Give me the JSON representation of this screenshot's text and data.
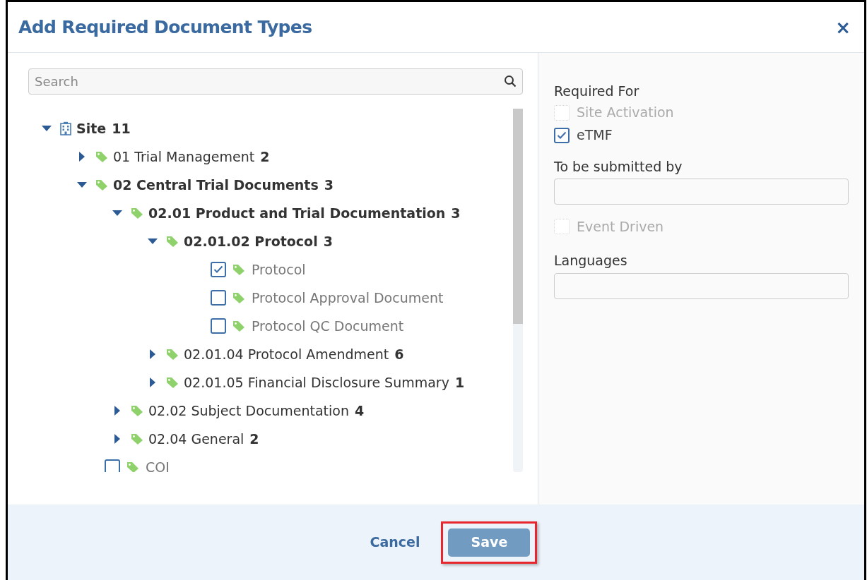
{
  "dialog": {
    "title": "Add Required Document Types",
    "close": "×"
  },
  "search": {
    "placeholder": "Search"
  },
  "tree": [
    {
      "kind": "site",
      "name": "Site",
      "count": "11",
      "expanded": true,
      "children": [
        {
          "kind": "folder",
          "name": "01 Trial Management",
          "count": "2",
          "expanded": false
        },
        {
          "kind": "folder",
          "name": "02 Central Trial Documents",
          "count": "3",
          "expanded": true,
          "children": [
            {
              "kind": "folder",
              "name": "02.01 Product and Trial Documentation",
              "count": "3",
              "expanded": true,
              "children": [
                {
                  "kind": "folder",
                  "name": "02.01.02 Protocol",
                  "count": "3",
                  "expanded": true,
                  "children": [
                    {
                      "kind": "document",
                      "name": "Protocol",
                      "checked": true
                    },
                    {
                      "kind": "document",
                      "name": "Protocol Approval Document",
                      "checked": false
                    },
                    {
                      "kind": "document",
                      "name": "Protocol QC Document",
                      "checked": false
                    }
                  ]
                },
                {
                  "kind": "folder",
                  "name": "02.01.04 Protocol Amendment",
                  "count": "6",
                  "expanded": false
                },
                {
                  "kind": "folder",
                  "name": "02.01.05 Financial Disclosure Summary",
                  "count": "1",
                  "expanded": false
                }
              ]
            },
            {
              "kind": "folder",
              "name": "02.02 Subject Documentation",
              "count": "4",
              "expanded": false
            },
            {
              "kind": "folder",
              "name": "02.04 General",
              "count": "2",
              "expanded": false
            }
          ]
        },
        {
          "kind": "document",
          "name": "COI",
          "checked": false
        }
      ]
    }
  ],
  "required_for": {
    "label": "Required For",
    "options": [
      {
        "label": "Site Activation",
        "checked": false,
        "disabled": true
      },
      {
        "label": "eTMF",
        "checked": true,
        "disabled": false
      }
    ]
  },
  "submitted_by": {
    "label": "To be submitted by"
  },
  "event_driven": {
    "label": "Event Driven",
    "checked": false,
    "disabled": true
  },
  "languages": {
    "label": "Languages"
  },
  "footer": {
    "cancel": "Cancel",
    "save": "Save",
    "save_highlighted": true
  }
}
